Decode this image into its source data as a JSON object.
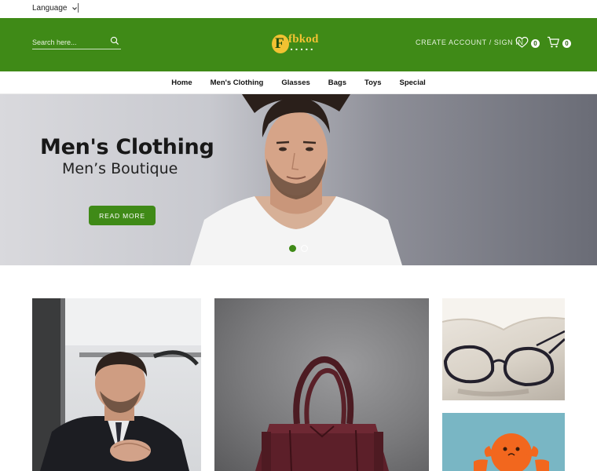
{
  "topbar": {
    "language_label": "Language"
  },
  "header": {
    "search_placeholder": "Search here...",
    "logo_text": "fbkod",
    "logo_initial": "F",
    "create_account": "CREATE ACCOUNT",
    "sign_in": "SIGN IN",
    "separator": "/",
    "wishlist_count": "0",
    "cart_count": "0"
  },
  "nav": {
    "items": [
      {
        "label": "Home"
      },
      {
        "label": "Men's Clothing"
      },
      {
        "label": "Glasses"
      },
      {
        "label": "Bags"
      },
      {
        "label": "Toys"
      },
      {
        "label": "Special"
      }
    ]
  },
  "hero": {
    "title": "Men's Clothing",
    "subtitle": "Men’s Boutique",
    "button_label": "READ MORE"
  },
  "banners": [
    {
      "name": "man-in-suit"
    },
    {
      "name": "burgundy-handbag"
    },
    {
      "name": "eyeglasses"
    },
    {
      "name": "orange-octopus-toy"
    }
  ],
  "colors": {
    "brand_green": "#3f8a17",
    "logo_yellow": "#f1c232",
    "white": "#ffffff"
  },
  "icons": [
    "chevron-down-icon",
    "search-icon",
    "heart-icon",
    "cart-icon"
  ]
}
